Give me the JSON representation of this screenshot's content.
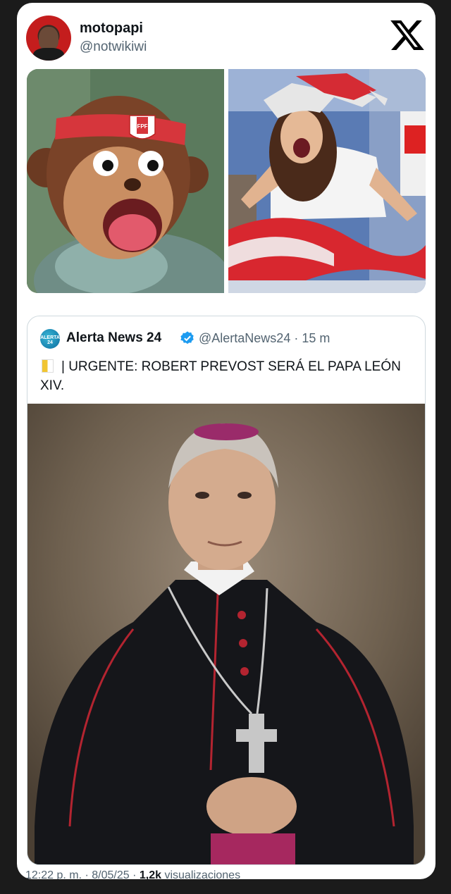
{
  "post": {
    "display_name": "motopapi",
    "handle": "@notwikiwi",
    "logo": "x-logo",
    "media": [
      {
        "description_icon": "monkey-puppet-image",
        "badge": "FPF"
      },
      {
        "description_icon": "reporter-celebrating-image"
      }
    ]
  },
  "quote": {
    "name": "Alerta News 24",
    "logo_label": "ALERTA 24",
    "verified_icon": "verified-badge-icon",
    "handle_time": "@AlertaNews24 · 15 m",
    "text": "| URGENTE: ROBERT PREVOST SERÁ EL PAPA LEÓN XIV."
  },
  "footer": {
    "time": "12:22 p. m. · 8/05/25 · ",
    "views_count": "1,2k",
    "views_label": " visualizaciones"
  },
  "colors": {
    "background": "#1b1b1b",
    "card": "#ffffff",
    "text": "#0f1419",
    "secondary": "#536471",
    "verified": "#1d9bf0"
  }
}
